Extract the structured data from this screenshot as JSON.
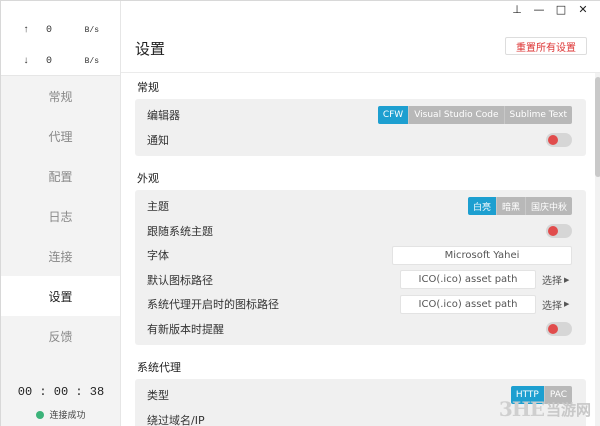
{
  "window": {
    "pin_glyph": "⊥",
    "minimize_glyph": "—",
    "maximize_glyph": "□",
    "close_glyph": "✕"
  },
  "traffic": {
    "up_arrow": "↑",
    "up_value": "0",
    "up_unit": "B/s",
    "down_arrow": "↓",
    "down_value": "0",
    "down_unit": "B/s"
  },
  "sidebar": {
    "items": [
      {
        "label": "常规"
      },
      {
        "label": "代理"
      },
      {
        "label": "配置"
      },
      {
        "label": "日志"
      },
      {
        "label": "连接"
      },
      {
        "label": "设置"
      },
      {
        "label": "反馈"
      }
    ],
    "active_index": 5,
    "timer": "00 : 00 : 38",
    "status": "连接成功",
    "status_color": "#3cb37a"
  },
  "header": {
    "title": "设置",
    "reset_label": "重置所有设置"
  },
  "sections": {
    "general": {
      "title": "常规",
      "editor_label": "编辑器",
      "editor_options": [
        "CFW",
        "Visual Studio Code",
        "Sublime Text"
      ],
      "editor_selected": "CFW",
      "notify_label": "通知"
    },
    "appearance": {
      "title": "外观",
      "theme_label": "主题",
      "theme_options": [
        "白亮",
        "暗黑",
        "国庆中秋"
      ],
      "theme_selected": "白亮",
      "follow_system_label": "跟随系统主题",
      "font_label": "字体",
      "font_value": "Microsoft Yahei",
      "default_icon_label": "默认图标路径",
      "default_icon_placeholder": "ICO(.ico) asset path",
      "default_icon_pick": "选择",
      "proxy_icon_label": "系统代理开启时的图标路径",
      "proxy_icon_placeholder": "ICO(.ico) asset path",
      "proxy_icon_pick": "选择",
      "update_notify_label": "有新版本时提醒"
    },
    "system_proxy": {
      "title": "系统代理",
      "type_label": "类型",
      "type_options": [
        "HTTP",
        "PAC"
      ],
      "type_selected": "HTTP",
      "bypass_label": "绕过域名/IP"
    }
  },
  "colors": {
    "accent": "#1d9fd0",
    "toggle_knob": "#e14c4c",
    "reset_text": "#dd3333"
  },
  "watermark": {
    "logo": "3HE",
    "text": "当游网"
  }
}
